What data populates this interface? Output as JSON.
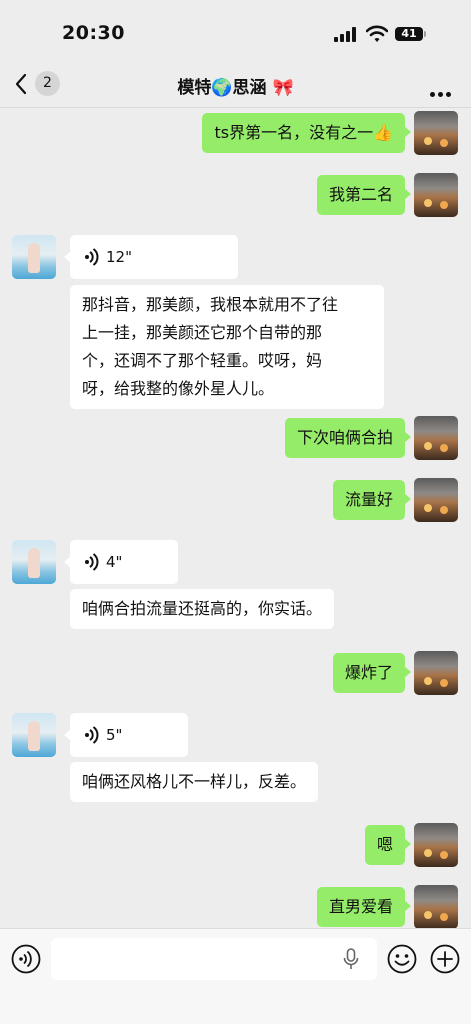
{
  "status": {
    "time": "20:30",
    "battery": "41"
  },
  "nav": {
    "back_count": "2",
    "title": "模特🌍思涵 🎀"
  },
  "messages": [
    {
      "side": "right",
      "type": "text",
      "text": "ts界第一名，没有之一👍"
    },
    {
      "side": "right",
      "type": "text",
      "text": "我第二名"
    },
    {
      "side": "left",
      "type": "voice",
      "duration": "12\""
    },
    {
      "side": "left",
      "type": "transcript",
      "lines": [
        "那抖音，那美颜，我根本就用不了往",
        "上一挂，那美颜还它那个自带的那",
        "个，还调不了那个轻重。哎呀，妈",
        "呀，给我整的像外星人儿。"
      ]
    },
    {
      "side": "right",
      "type": "text",
      "text": "下次咱俩合拍"
    },
    {
      "side": "right",
      "type": "text",
      "text": "流量好"
    },
    {
      "side": "left",
      "type": "voice",
      "duration": "4\""
    },
    {
      "side": "left",
      "type": "transcript",
      "text": "咱俩合拍流量还挺高的，你实话。"
    },
    {
      "side": "right",
      "type": "text",
      "text": "爆炸了"
    },
    {
      "side": "left",
      "type": "voice",
      "duration": "5\""
    },
    {
      "side": "left",
      "type": "transcript",
      "text": "咱俩还风格儿不一样儿，反差。"
    },
    {
      "side": "right",
      "type": "text",
      "text": "嗯"
    },
    {
      "side": "right",
      "type": "text",
      "text": "直男爱看"
    }
  ],
  "colors": {
    "background": "#ededed",
    "sent_bubble": "#95ec69",
    "received_bubble": "#ffffff"
  },
  "icons": {
    "voice_toggle": "voice-icon",
    "mic": "mic-icon",
    "emoji": "emoji-icon",
    "more_actions": "plus-icon"
  }
}
